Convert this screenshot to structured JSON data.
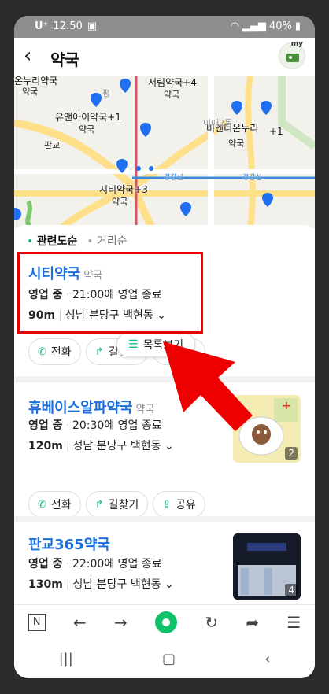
{
  "status": {
    "carrier": "U⁺",
    "time": "12:50",
    "battery": "40%"
  },
  "appbar": {
    "title": "약국",
    "my_label": "my"
  },
  "map": {
    "labels": [
      "온누리약국",
      "약국",
      "서림약국+4",
      "약국",
      "유앤아이약국+1",
      "약국",
      "비엔디온누리",
      "약국",
      "+1",
      "시티약국+3",
      "약국",
      "판교",
      "경강선",
      "경강선",
      "평",
      "이매2동"
    ]
  },
  "sort": {
    "active": "관련도순",
    "inactive": "거리순"
  },
  "items": [
    {
      "name": "시티약국",
      "category": "약국",
      "status": "영업 중",
      "hours": "21:00에 영업 종료",
      "distance": "90m",
      "address": "성남 분당구 백현동"
    },
    {
      "name": "휴베이스알파약국",
      "category": "약국",
      "status": "영업 중",
      "hours": "20:30에 영업 종료",
      "distance": "120m",
      "address": "성남 분당구 백현동",
      "photo_count": "2"
    },
    {
      "name": "판교365약국",
      "category": "",
      "status": "영업 중",
      "hours": "22:00에 영업 종료",
      "distance": "130m",
      "address": "성남 분당구 백현동",
      "photo_count": "4"
    }
  ],
  "actions": {
    "call": "전화",
    "route": "길찾기",
    "share": "공유"
  },
  "list_view_button": "목록보기",
  "colors": {
    "accent": "#12b886",
    "link": "#1a6fdc",
    "highlight": "#e60000"
  }
}
